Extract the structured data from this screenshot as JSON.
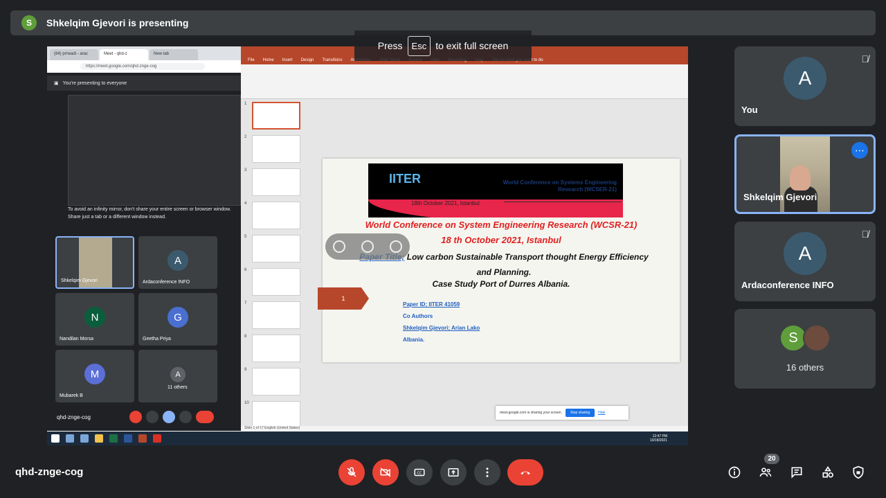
{
  "presenting": {
    "initial": "S",
    "text": "Shkelqim Gjevori is presenting"
  },
  "fullscreen_hint": {
    "before": "Press",
    "key": "Esc",
    "after": "to exit full screen"
  },
  "shared_screen": {
    "browser_tabs": [
      "(84) prrwadi - arac",
      "Meet - qhd-z",
      "New tab"
    ],
    "address": "https://meet.google.com/qhd-znge-cog",
    "share_note": "You're presenting to everyone",
    "mirror_warning": "To avoid an infinity mirror, don't share your entire screen or browser window. Share just a tab or a different window instead.",
    "mini_tiles": [
      {
        "name": "Shkelqim Gjevori"
      },
      {
        "name": "Ardaconference INFO",
        "initial": "A"
      },
      {
        "name": "Nandilan Morsa",
        "initial": "N"
      },
      {
        "name": "Geetha Priya",
        "initial": "G"
      },
      {
        "name": "Mubarek B",
        "initial": "M"
      },
      {
        "name": "11 others",
        "initial": "A"
      }
    ],
    "mini_meeting_code": "qhd-znge-cog",
    "ppt_tabs": [
      "File",
      "Home",
      "Insert",
      "Design",
      "Transitions",
      "Animations",
      "Slide Show",
      "Review",
      "View",
      "Recording",
      "Help",
      "Tell me what you want to do"
    ],
    "slide": {
      "logo": "IITER",
      "conference_header": "World Conference on Systems Engineering Research (WCSER-21)",
      "date_line": "18th October 2021, Istanbul",
      "title1": "World Conference on System Engineering Research (WCSR-21)",
      "title2": "18 th October 2021, Istanbul",
      "paper_label": "Paper Title;",
      "paper_title": "Low carbon Sustainable Transport thought Energy Efficiency and Planning.",
      "case_study": "Case Study Port of Durres Albania.",
      "paper_id": "Paper ID; IITER 41059",
      "co_authors": "Co Authors",
      "authors": "Shkelqim Gjevori; Arian Lako",
      "country": "Albania.",
      "slide_number": "1"
    },
    "thumb_numbers": [
      "1",
      "2",
      "3",
      "4",
      "5",
      "6",
      "7",
      "8",
      "9",
      "10"
    ],
    "sharing_bar": {
      "text": "meet.google.com is sharing your screen.",
      "stop": "Stop sharing",
      "hide": "Hide"
    },
    "status": "Slide 1 of 17    English (United States)",
    "clock": {
      "time": "12:47 PM",
      "date": "10/18/2021"
    }
  },
  "participants": [
    {
      "name": "You",
      "initial": "A",
      "muted": true
    },
    {
      "name": "Shkelqim Gjevori",
      "active": true
    },
    {
      "name": "Ardaconference INFO",
      "initial": "A",
      "muted": true
    },
    {
      "name": "16 others",
      "initial": "S"
    }
  ],
  "meeting_code": "qhd-znge-cog",
  "people_count": "20",
  "icons": {
    "mic": "mic-off-icon",
    "camera": "camera-off-icon",
    "captions": "captions-icon",
    "present": "present-icon",
    "more": "more-vert-icon",
    "hangup": "hangup-icon",
    "info": "info-icon",
    "people": "people-icon",
    "chat": "chat-icon",
    "activities": "activities-icon",
    "host": "host-controls-icon"
  },
  "colors": {
    "background": "#202124",
    "tile": "#3c4043",
    "red": "#ea4335",
    "active_border": "#8ab4f8",
    "accent": "#1a73e8",
    "ppt": "#b7472a"
  }
}
